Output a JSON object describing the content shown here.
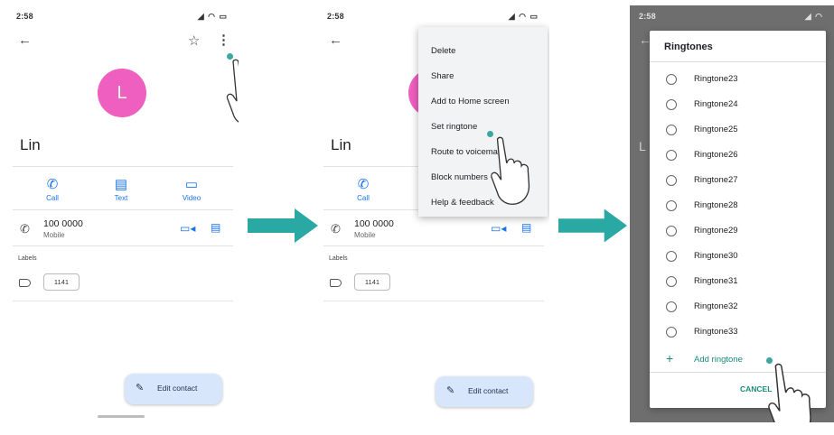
{
  "colors": {
    "accent": "#1a73e8",
    "avatar": "#ef5fbf",
    "arrow": "#2aa9a4",
    "dialog_accent": "#1a8a7c"
  },
  "status_bar": {
    "time": "2:58",
    "indicators": "⁂ ▣ G ▲",
    "right": "▯ ◔ ▭"
  },
  "screen1": {
    "avatar_letter": "L",
    "contact_name": "Lin",
    "actions": [
      {
        "label": "Call",
        "icon": "phone-icon"
      },
      {
        "label": "Text",
        "icon": "message-icon"
      },
      {
        "label": "Video",
        "icon": "video-icon"
      }
    ],
    "phone_number": "100 0000",
    "phone_type": "Mobile",
    "labels_heading": "Labels",
    "label_chip": "1141",
    "fab_label": "Edit contact"
  },
  "screen2": {
    "contact_name": "Lin",
    "menu_items": [
      "Delete",
      "Share",
      "Add to Home screen",
      "Set ringtone",
      "Route to voicemail",
      "Block numbers",
      "Help & feedback"
    ],
    "actions": [
      {
        "label": "Call",
        "icon": "phone-icon"
      }
    ],
    "phone_number": "100 0000",
    "phone_type": "Mobile",
    "labels_heading": "Labels",
    "label_chip": "1141",
    "fab_label": "Edit contact"
  },
  "screen3": {
    "dialog_title": "Ringtones",
    "ringtones": [
      "Ringtone23",
      "Ringtone24",
      "Ringtone25",
      "Ringtone26",
      "Ringtone27",
      "Ringtone28",
      "Ringtone29",
      "Ringtone30",
      "Ringtone31",
      "Ringtone32",
      "Ringtone33"
    ],
    "add_label": "Add ringtone",
    "cancel_label": "CANCEL"
  }
}
